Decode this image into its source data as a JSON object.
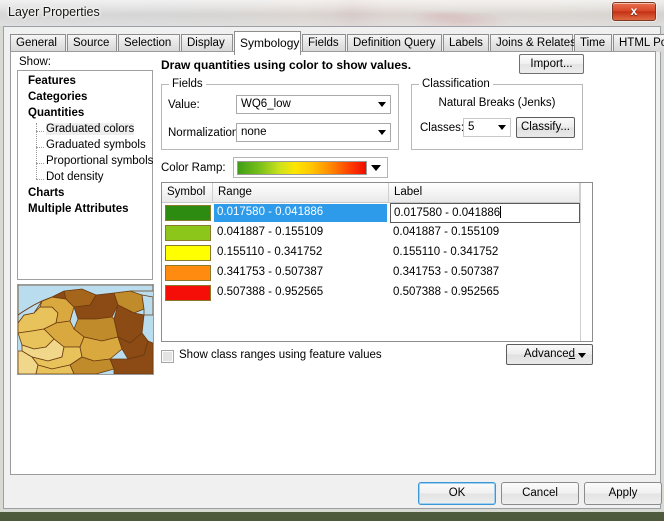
{
  "window": {
    "title": "Layer Properties",
    "close_label": "x"
  },
  "tabs": [
    {
      "label": "General",
      "active": false
    },
    {
      "label": "Source",
      "active": false
    },
    {
      "label": "Selection",
      "active": false
    },
    {
      "label": "Display",
      "active": false
    },
    {
      "label": "Symbology",
      "active": true
    },
    {
      "label": "Fields",
      "active": false
    },
    {
      "label": "Definition Query",
      "active": false
    },
    {
      "label": "Labels",
      "active": false
    },
    {
      "label": "Joins & Relates",
      "active": false
    },
    {
      "label": "Time",
      "active": false
    },
    {
      "label": "HTML Popup",
      "active": false
    }
  ],
  "show": {
    "caption": "Show:",
    "items": [
      {
        "label": "Features",
        "level": 0,
        "selected": false
      },
      {
        "label": "Categories",
        "level": 0,
        "selected": false
      },
      {
        "label": "Quantities",
        "level": 0,
        "selected": false
      },
      {
        "label": "Graduated colors",
        "level": 1,
        "selected": true
      },
      {
        "label": "Graduated symbols",
        "level": 1,
        "selected": false
      },
      {
        "label": "Proportional symbols",
        "level": 1,
        "selected": false
      },
      {
        "label": "Dot density",
        "level": 1,
        "selected": false
      },
      {
        "label": "Charts",
        "level": 0,
        "selected": false
      },
      {
        "label": "Multiple Attributes",
        "level": 0,
        "selected": false
      }
    ]
  },
  "headline": "Draw quantities using color to show values.",
  "import_button": "Import...",
  "fields": {
    "group_title": "Fields",
    "value_label": "Value:",
    "value_selected": "WQ6_low",
    "normalization_label": "Normalization:",
    "normalization_selected": "none"
  },
  "classification": {
    "group_title": "Classification",
    "method": "Natural Breaks (Jenks)",
    "classes_label": "Classes:",
    "classes_selected": "5",
    "classify_button": "Classify..."
  },
  "color_ramp": {
    "label": "Color Ramp:",
    "stops": [
      "#3f9e15",
      "#7cc21b",
      "#cfe21c",
      "#ffe600",
      "#ffc400",
      "#ff8a00",
      "#ff3c00",
      "#ef0d00"
    ]
  },
  "grid": {
    "headers": [
      "Symbol",
      "Range",
      "Label"
    ],
    "rows": [
      {
        "color": "#2e8b12",
        "range": "0.017580 - 0.041886",
        "label": "0.017580 - 0.041886",
        "selected": true
      },
      {
        "color": "#8dc61a",
        "range": "0.041887 - 0.155109",
        "label": "0.041887 - 0.155109",
        "selected": false
      },
      {
        "color": "#ffff00",
        "range": "0.155110 - 0.341752",
        "label": "0.155110 - 0.341752",
        "selected": false
      },
      {
        "color": "#ff8c10",
        "range": "0.341753 - 0.507387",
        "label": "0.341753 - 0.507387",
        "selected": false
      },
      {
        "color": "#f50d08",
        "range": "0.507388 - 0.952565",
        "label": "0.507388 - 0.952565",
        "selected": false
      }
    ]
  },
  "show_class_ranges": {
    "label": "Show class ranges using feature values",
    "checked": false
  },
  "advanced_button": "Advance",
  "advanced_button_underlined": "d",
  "dialog_buttons": {
    "ok": "OK",
    "cancel": "Cancel",
    "apply": "Apply"
  },
  "map_preview": {
    "ocean_color": "#b9dcef",
    "land_colors": [
      "#e8c35c",
      "#d9a83e",
      "#8c4a14",
      "#c08b2a",
      "#f0d78a",
      "#a5661c"
    ]
  }
}
